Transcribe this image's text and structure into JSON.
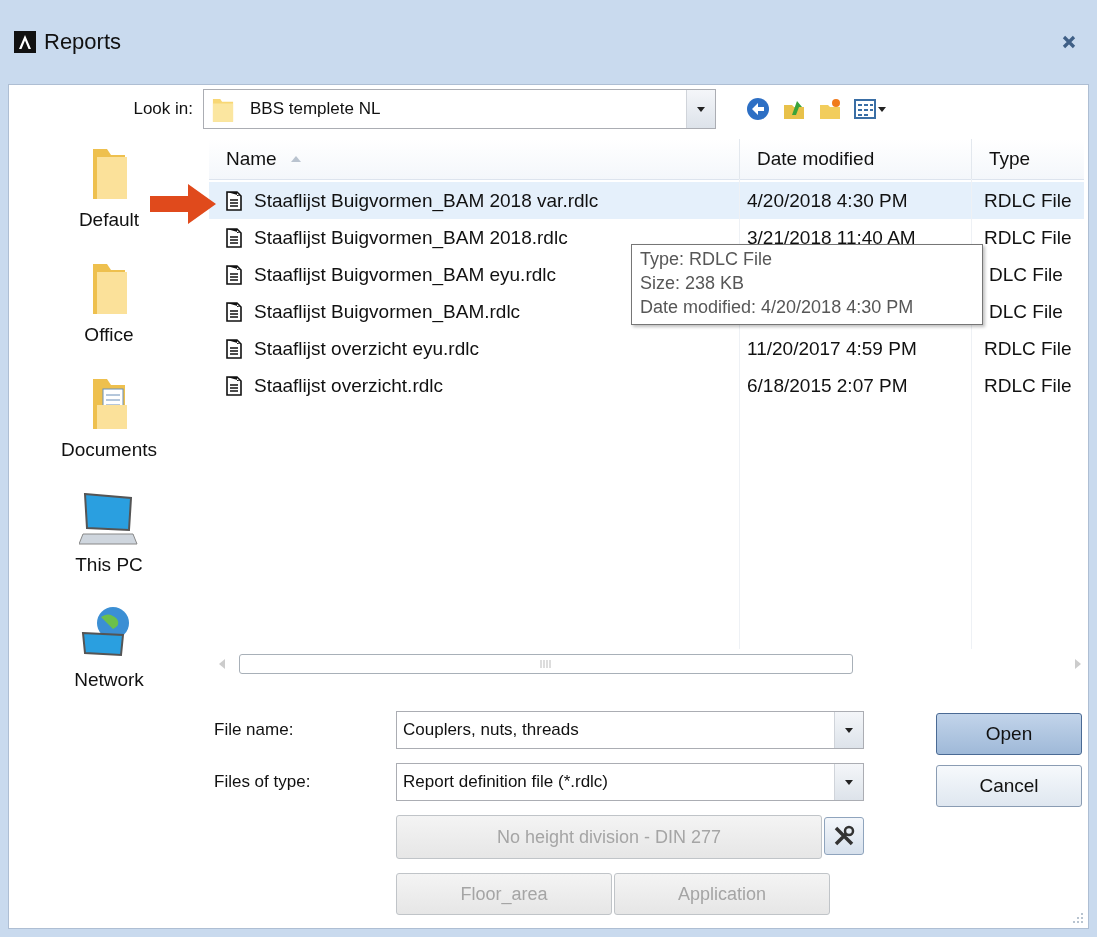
{
  "window": {
    "title": "Reports"
  },
  "look_in": {
    "label": "Look in:",
    "value": "BBS templete NL"
  },
  "places": [
    {
      "label": "Default",
      "kind": "folder"
    },
    {
      "label": "Office",
      "kind": "folder"
    },
    {
      "label": "Documents",
      "kind": "documents"
    },
    {
      "label": "This PC",
      "kind": "computer"
    },
    {
      "label": "Network",
      "kind": "network"
    }
  ],
  "file_list": {
    "columns": [
      {
        "label": "Name",
        "sorted": true
      },
      {
        "label": "Date modified",
        "sorted": false
      },
      {
        "label": "Type",
        "sorted": false
      }
    ],
    "rows": [
      {
        "name": "Staaflijst Buigvormen_BAM 2018 var.rdlc",
        "date": "4/20/2018 4:30 PM",
        "type": "RDLC File",
        "selected": true
      },
      {
        "name": "Staaflijst Buigvormen_BAM 2018.rdlc",
        "date": "3/21/2018 11:40 AM",
        "type": "RDLC File",
        "selected": false
      },
      {
        "name": "Staaflijst Buigvormen_BAM eyu.rdlc",
        "type": "DLC File",
        "selected": false
      },
      {
        "name": "Staaflijst Buigvormen_BAM.rdlc",
        "type": "DLC File",
        "selected": false
      },
      {
        "name": "Staaflijst overzicht eyu.rdlc",
        "date": "11/20/2017 4:59 PM",
        "type": "RDLC File",
        "selected": false
      },
      {
        "name": "Staaflijst overzicht.rdlc",
        "date": "6/18/2015 2:07 PM",
        "type": "RDLC File",
        "selected": false
      }
    ],
    "tooltip": [
      "Type: RDLC File",
      "Size: 238 KB",
      "Date modified: 4/20/2018 4:30 PM"
    ]
  },
  "file_name": {
    "label": "File name:",
    "value": "Couplers, nuts, threads"
  },
  "file_type": {
    "label": "Files of type:",
    "value": "Report definition file (*.rdlc)"
  },
  "buttons": [
    {
      "label": "Open",
      "kind": "default"
    },
    {
      "label": "Cancel",
      "kind": "normal"
    }
  ],
  "options": [
    {
      "label": "No height division - DIN  277",
      "disabled": true
    },
    {
      "label": "Floor_area",
      "disabled": true
    },
    {
      "label": "Application",
      "disabled": true
    }
  ]
}
